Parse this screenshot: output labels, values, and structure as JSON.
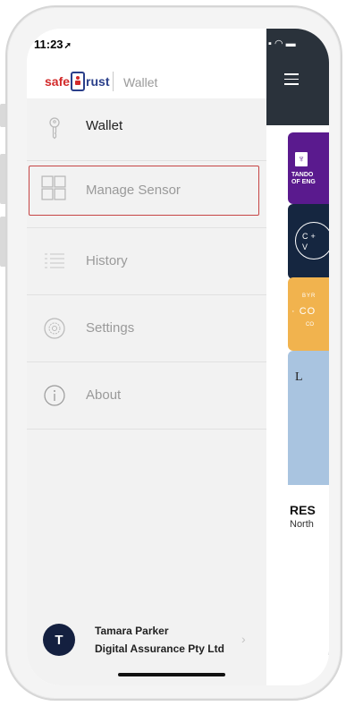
{
  "status": {
    "time": "11:23",
    "arrow": "➚"
  },
  "brand": {
    "logo_part1": "safe",
    "logo_part2": "rust",
    "section": "Wallet"
  },
  "menu": {
    "items": [
      {
        "label": "Wallet",
        "icon": "key-icon",
        "active": true
      },
      {
        "label": "Manage Sensor",
        "icon": "grid-icon",
        "selected": true
      },
      {
        "label": "History",
        "icon": "list-icon"
      },
      {
        "label": "Settings",
        "icon": "gear-icon"
      },
      {
        "label": "About",
        "icon": "info-icon"
      }
    ]
  },
  "user": {
    "initial": "T",
    "name": "Tamara Parker",
    "organization": "Digital Assurance Pty Ltd"
  },
  "content": {
    "cards": [
      {
        "text": "TANDO\nOF ENG"
      },
      {
        "text": "C+\nV"
      },
      {
        "line1": "BYR",
        "line2": "· CO",
        "line3": "CO"
      },
      {
        "text": "L"
      }
    ],
    "result_title": "RES",
    "result_subtitle": "North"
  },
  "colors": {
    "highlight_border": "#c64545",
    "nav_dark": "#2a323b",
    "avatar": "#142040"
  }
}
